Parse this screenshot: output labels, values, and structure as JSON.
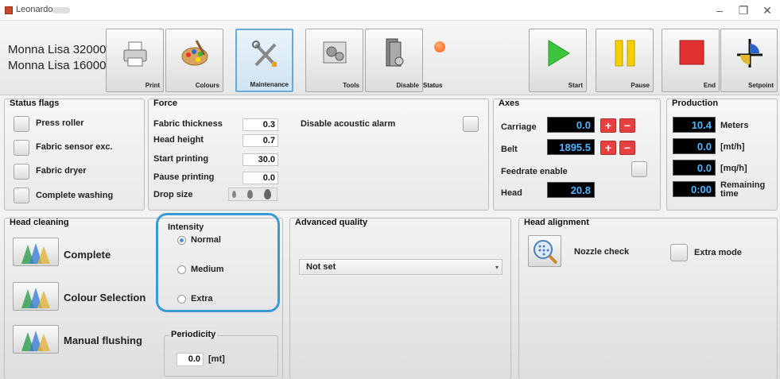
{
  "window": {
    "title": "Leonardo",
    "minimize": "–",
    "maximize": "❐",
    "close": "✕"
  },
  "models": [
    "Monna Lisa 32000",
    "Monna Lisa 16000"
  ],
  "toolbar": {
    "print": "Print",
    "colours": "Colours",
    "maintenance": "Maintenance",
    "tools": "Tools",
    "disable": "Disable",
    "status": "Status",
    "start": "Start",
    "pause": "Pause",
    "end": "End",
    "setpoint": "Setpoint"
  },
  "status_flags": {
    "title": "Status flags",
    "items": [
      "Press roller",
      "Fabric sensor exc.",
      "Fabric dryer",
      "Complete washing"
    ]
  },
  "force": {
    "title": "Force",
    "rows": [
      {
        "label": "Fabric thickness",
        "value": "0.3"
      },
      {
        "label": "Head height",
        "value": "0.7"
      },
      {
        "label": "Start printing",
        "value": "30.0"
      },
      {
        "label": "Pause printing",
        "value": "0.0"
      }
    ],
    "drop_size": "Drop size",
    "alarm": "Disable acoustic alarm"
  },
  "axes": {
    "title": "Axes",
    "carriage": "Carriage",
    "carriage_value": "0.0",
    "belt": "Belt",
    "belt_value": "1895.5",
    "feedrate": "Feedrate enable",
    "head": "Head",
    "head_value": "20.8",
    "plus": "+",
    "minus": "−"
  },
  "production": {
    "title": "Production",
    "rows": [
      {
        "value": "10.4",
        "unit": "Meters"
      },
      {
        "value": "0.0",
        "unit": "[mt/h]"
      },
      {
        "value": "0.0",
        "unit": "[mq/h]"
      },
      {
        "value": "0:00",
        "unit": "Remaining time"
      }
    ]
  },
  "head_cleaning": {
    "title": "Head cleaning",
    "items": [
      "Complete",
      "Colour Selection",
      "Manual flushing"
    ]
  },
  "intensity": {
    "title": "Intensity",
    "options": [
      "Normal",
      "Medium",
      "Extra"
    ],
    "selected": "Normal"
  },
  "periodicity": {
    "title": "Periodicity",
    "value": "0.0",
    "unit": "[mt]"
  },
  "advanced_quality": {
    "title": "Advanced quality",
    "value": "Not set"
  },
  "head_alignment": {
    "title": "Head alignment",
    "nozzle_check": "Nozzle check",
    "extra_mode": "Extra mode"
  },
  "colors": {
    "accent_highlight": "#3a9ad6",
    "lcd_text": "#4fb4ff",
    "red_button": "#e03030",
    "start_green": "#3cc43c",
    "pause_yellow": "#f5d000"
  }
}
